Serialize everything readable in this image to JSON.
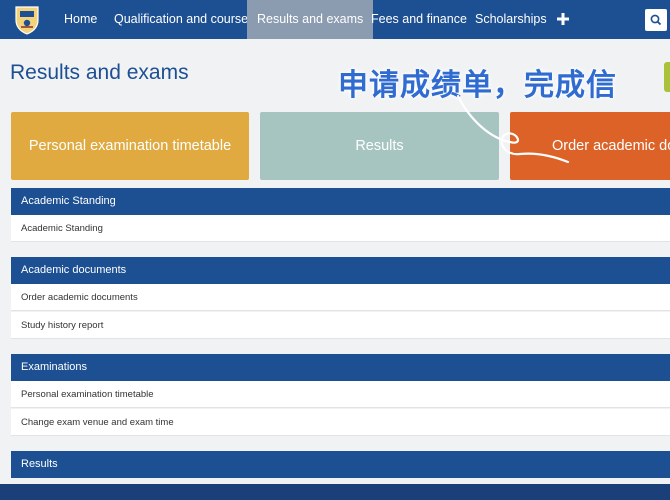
{
  "nav": {
    "items": [
      {
        "label": "Home"
      },
      {
        "label": "Qualification and courses"
      },
      {
        "label": "Results and exams"
      },
      {
        "label": "Fees and finance"
      },
      {
        "label": "Scholarships"
      }
    ]
  },
  "page": {
    "title": "Results and exams",
    "overlay_text": "申请成绩单，完成信"
  },
  "tiles": [
    {
      "label": "Personal examination timetable",
      "color": "#e0aa41"
    },
    {
      "label": "Results",
      "color": "#a6c4c0"
    },
    {
      "label": "Order academic docu",
      "color": "#dd6228"
    }
  ],
  "sections": [
    {
      "title": "Academic Standing",
      "links": [
        "Academic Standing"
      ]
    },
    {
      "title": "Academic documents",
      "links": [
        "Order academic documents",
        "Study history report"
      ]
    },
    {
      "title": "Examinations",
      "links": [
        "Personal examination timetable",
        "Change exam venue and exam time"
      ]
    },
    {
      "title": "Results",
      "links": []
    }
  ],
  "colors": {
    "primary": "#1d4f93",
    "active_nav": "#8b9bb0"
  }
}
